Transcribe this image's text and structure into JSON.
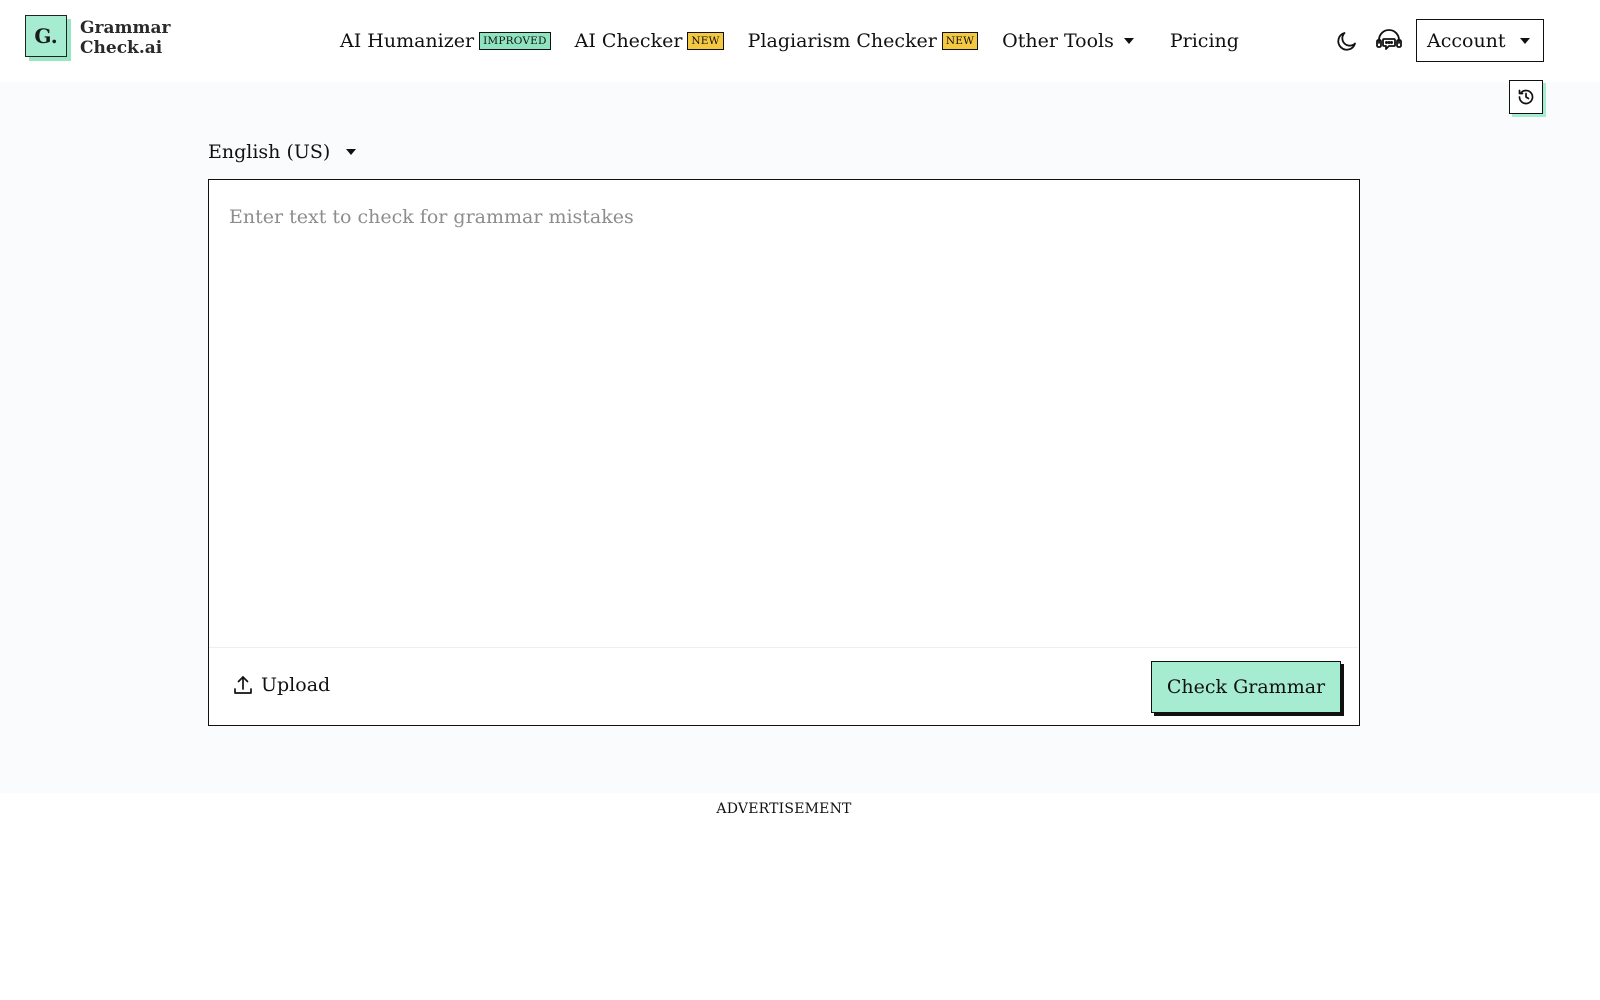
{
  "logo": {
    "letter": "G.",
    "line1": "Grammar",
    "line2": "Check.ai"
  },
  "nav": {
    "items": [
      {
        "label": "AI Humanizer",
        "badge": "IMPROVED"
      },
      {
        "label": "AI Checker",
        "badge": "NEW"
      },
      {
        "label": "Plagiarism Checker",
        "badge": "NEW"
      },
      {
        "label": "Other Tools"
      },
      {
        "label": "Pricing"
      }
    ]
  },
  "header_icons": {
    "theme": "moon-icon",
    "support": "headset-icon",
    "history": "history-icon"
  },
  "account": {
    "label": "Account"
  },
  "language": {
    "selected": "English (US)"
  },
  "editor": {
    "placeholder": "Enter text to check for grammar mistakes",
    "upload_label": "Upload",
    "submit_label": "Check Grammar"
  },
  "ad": {
    "label": "ADVERTISEMENT"
  },
  "colors": {
    "accent": "#a5ecd0",
    "badge_improved": "#8fe3bf",
    "badge_new": "#f5c842",
    "background": "#fafbfc"
  }
}
